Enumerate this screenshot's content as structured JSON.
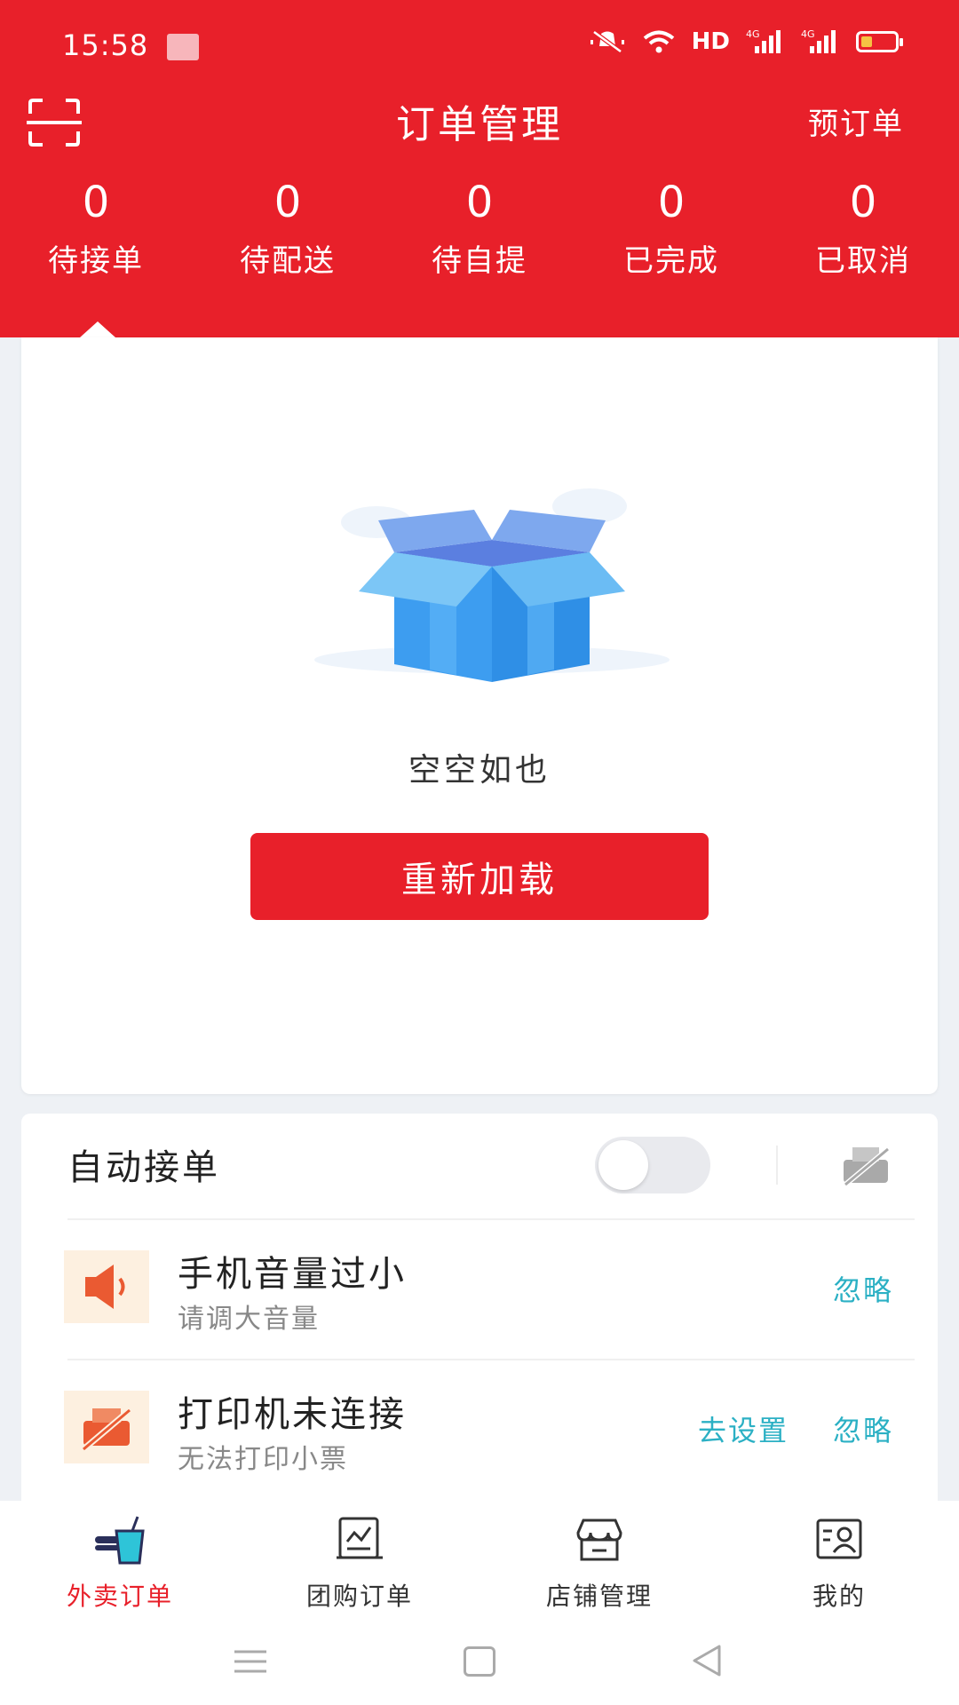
{
  "status_bar": {
    "time": "15:58",
    "net_label": "HD",
    "signal1": "4G",
    "signal2": "4G",
    "icons": [
      "mute-icon",
      "wifi-icon",
      "signal-icon",
      "battery-icon"
    ]
  },
  "header": {
    "title": "订单管理",
    "right_action": "预订单",
    "left_icon": "scan-icon",
    "background_color": "#e8202a"
  },
  "tabs": [
    {
      "count": "0",
      "label": "待接单",
      "selected": true
    },
    {
      "count": "0",
      "label": "待配送",
      "selected": false
    },
    {
      "count": "0",
      "label": "待自提",
      "selected": false
    },
    {
      "count": "0",
      "label": "已完成",
      "selected": false
    },
    {
      "count": "0",
      "label": "已取消",
      "selected": false
    }
  ],
  "empty_state": {
    "illustration": "open-box-icon",
    "message": "空空如也",
    "reload_label": "重新加载"
  },
  "auto_accept": {
    "label": "自动接单",
    "enabled": false,
    "printer_icon": "printer-disconnected-icon"
  },
  "alerts": [
    {
      "icon": "speaker-icon",
      "title": "手机音量过小",
      "subtitle": "请调大音量",
      "ignore_label": "忽略"
    },
    {
      "icon": "printer-off-icon",
      "title": "打印机未连接",
      "subtitle": "无法打印小票",
      "settings_label": "去设置",
      "ignore_label": "忽略"
    }
  ],
  "bottom_nav": [
    {
      "label": "外卖订单",
      "icon": "takeout-icon",
      "active": true
    },
    {
      "label": "团购订单",
      "icon": "group-order-icon",
      "active": false
    },
    {
      "label": "店铺管理",
      "icon": "store-icon",
      "active": false
    },
    {
      "label": "我的",
      "icon": "profile-icon",
      "active": false
    }
  ],
  "colors": {
    "accent": "#e8202a",
    "link": "#2bb0c4",
    "alert_bg": "#fdf0e0",
    "alert_icon": "#ea5a32"
  }
}
